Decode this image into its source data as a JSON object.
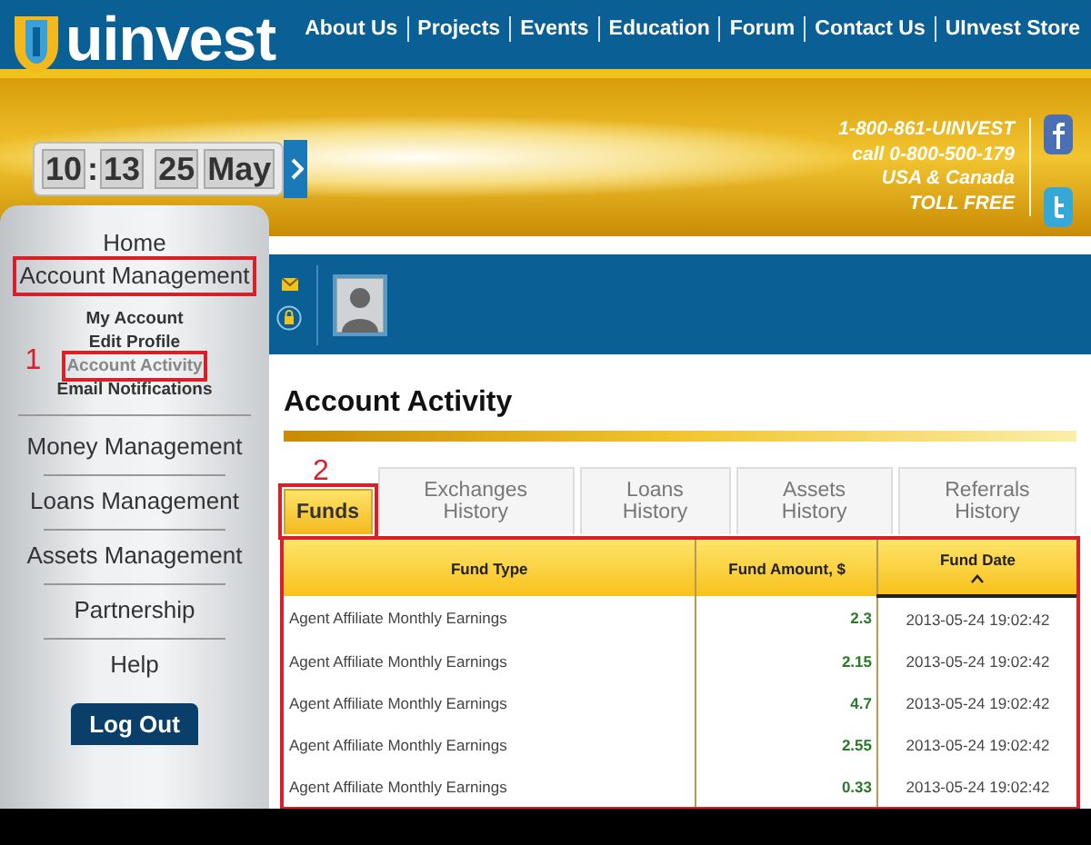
{
  "brand": {
    "name": "uinvest"
  },
  "nav": [
    "About Us",
    "Projects",
    "Events",
    "Education",
    "Forum",
    "Contact Us",
    "UInvest Store"
  ],
  "clock": {
    "hour": "10",
    "separator": ":",
    "minute": "13",
    "day": "25",
    "month": "May"
  },
  "contact": [
    "1-800-861-UINVEST",
    "call 0-800-500-179",
    "USA & Canada",
    "TOLL FREE"
  ],
  "sidebar": {
    "items": [
      {
        "label": "Home",
        "annotated": false
      },
      {
        "label": "Account Management",
        "annotated": true,
        "children": [
          {
            "label": "My Account",
            "selected": false,
            "annotated": false
          },
          {
            "label": "Edit Profile",
            "selected": false,
            "annotated": false
          },
          {
            "label": "Account Activity",
            "selected": true,
            "annotated": true,
            "callout": "1"
          },
          {
            "label": "Email Notifications",
            "selected": false,
            "annotated": false
          }
        ]
      },
      {
        "label": "Money Management",
        "annotated": false
      },
      {
        "label": "Loans Management",
        "annotated": false
      },
      {
        "label": "Assets Management",
        "annotated": false
      },
      {
        "label": "Partnership",
        "annotated": false
      },
      {
        "label": "Help",
        "annotated": false
      }
    ],
    "logout": "Log Out"
  },
  "page_title": "Account Activity",
  "tabs": [
    {
      "label": "Funds",
      "selected": true,
      "annotated": true,
      "callout": "2"
    },
    {
      "label": "Exchanges History",
      "selected": false,
      "annotated": false
    },
    {
      "label": "Loans History",
      "selected": false,
      "annotated": false
    },
    {
      "label": "Assets History",
      "selected": false,
      "annotated": false
    },
    {
      "label": "Referrals History",
      "selected": false,
      "annotated": false
    }
  ],
  "table": {
    "annotated": true,
    "columns": [
      {
        "label": "Fund Type",
        "sorted": false
      },
      {
        "label": "Fund Amount, $",
        "sorted": false
      },
      {
        "label": "Fund Date",
        "sorted": true
      }
    ],
    "rows": [
      [
        "Agent Affiliate Monthly Earnings",
        "2.3",
        "2013-05-24 19:02:42"
      ],
      [
        "Agent Affiliate Monthly Earnings",
        "2.15",
        "2013-05-24 19:02:42"
      ],
      [
        "Agent Affiliate Monthly Earnings",
        "4.7",
        "2013-05-24 19:02:42"
      ],
      [
        "Agent Affiliate Monthly Earnings",
        "2.55",
        "2013-05-24 19:02:42"
      ],
      [
        "Agent Affiliate Monthly Earnings",
        "0.33",
        "2013-05-24 19:02:42"
      ]
    ]
  }
}
